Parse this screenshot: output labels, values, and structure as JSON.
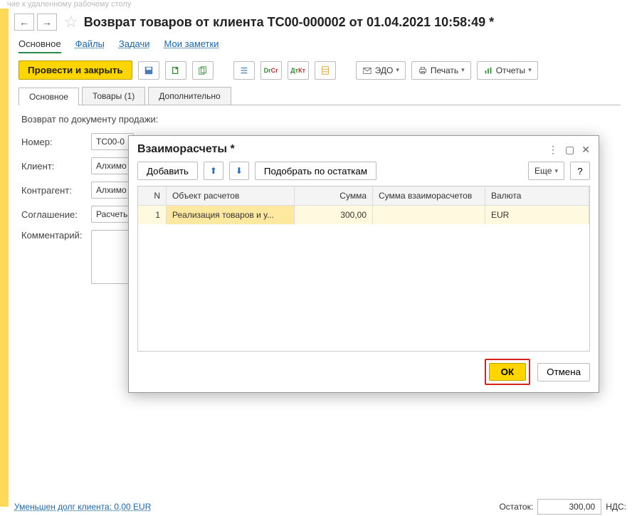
{
  "top_hint": "чие к удаленному рабочему столу",
  "nav": {
    "back": "←",
    "forward": "→"
  },
  "star": "☆",
  "page_title": "Возврат товаров от клиента ТС00-000002 от 01.04.2021 10:58:49 *",
  "links": {
    "main": "Основное",
    "files": "Файлы",
    "tasks": "Задачи",
    "notes": "Мои заметки"
  },
  "toolbar": {
    "post_close": "Провести и закрыть",
    "edo": "ЭДО",
    "print": "Печать",
    "reports": "Отчеты"
  },
  "tabs": {
    "main": "Основное",
    "goods": "Товары (1)",
    "additional": "Дополнительно"
  },
  "form": {
    "return_by_doc": "Возврат по документу продажи:",
    "number_label": "Номер:",
    "number_value": "ТС00-0",
    "client_label": "Клиент:",
    "client_value": "Алхимо",
    "contractor_label": "Контрагент:",
    "contractor_value": "Алхимо",
    "agreement_label": "Соглашение:",
    "agreement_value": "Расчеть",
    "comment_label": "Комментарий:"
  },
  "modal": {
    "title": "Взаиморасчеты *",
    "add": "Добавить",
    "pick": "Подобрать по остаткам",
    "more": "Еще",
    "help": "?",
    "cols": {
      "n": "N",
      "obj": "Объект расчетов",
      "sum": "Сумма",
      "settle": "Сумма взаиморасчетов",
      "cur": "Валюта"
    },
    "row": {
      "n": "1",
      "obj": "Реализация товаров и у...",
      "sum": "300,00",
      "settle": "",
      "cur": "EUR"
    },
    "ok": "ОК",
    "cancel": "Отмена"
  },
  "footer": {
    "debt": "Уменьшен долг клиента: 0,00 EUR",
    "balance_label": "Остаток:",
    "balance_value": "300,00",
    "vat_label": "НДС:"
  }
}
